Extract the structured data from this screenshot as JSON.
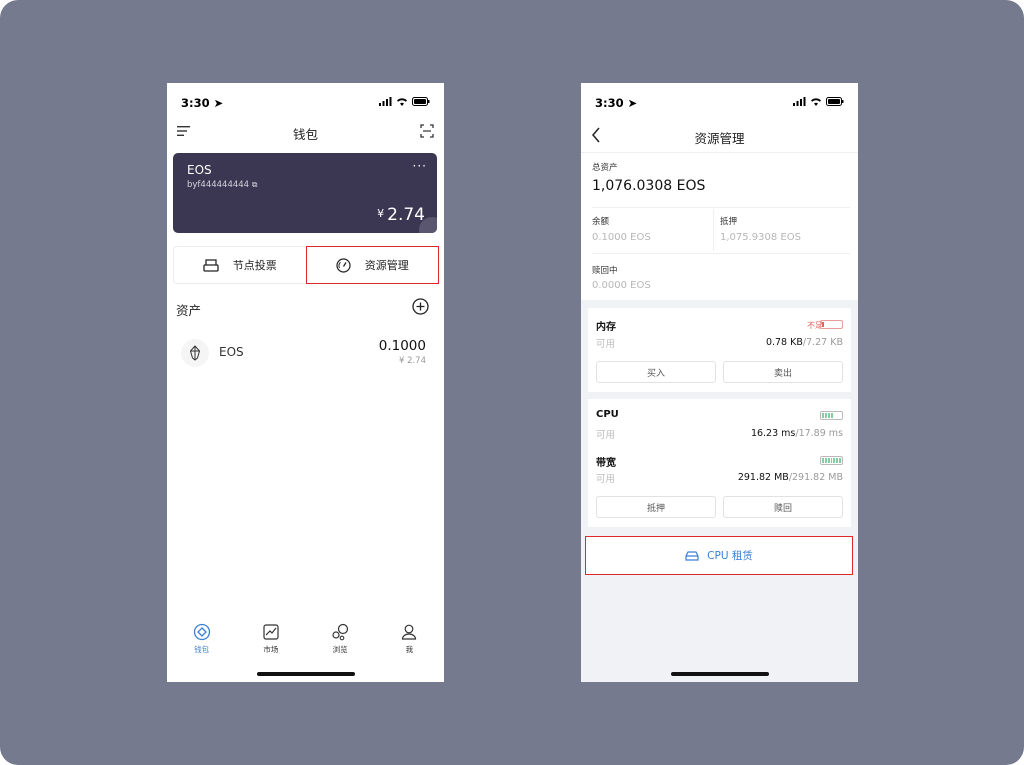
{
  "left": {
    "status": {
      "time": "3:30"
    },
    "nav": {
      "title": "钱包"
    },
    "wallet": {
      "name": "EOS",
      "address": "byf444444444",
      "more": "···",
      "currency": "¥",
      "balance": "2.74"
    },
    "actions": [
      {
        "label": "节点投票",
        "icon": "printer-icon"
      },
      {
        "label": "资源管理",
        "icon": "gauge-icon"
      }
    ],
    "assets": {
      "title": "资产",
      "items": [
        {
          "name": "EOS",
          "amount": "0.1000",
          "fiat": "¥ 2.74"
        }
      ]
    },
    "tabbar": [
      {
        "label": "钱包",
        "icon": "wallet-icon",
        "active": true
      },
      {
        "label": "市场",
        "icon": "chart-icon",
        "active": false
      },
      {
        "label": "浏览",
        "icon": "bubbles-icon",
        "active": false
      },
      {
        "label": "我",
        "icon": "user-icon",
        "active": false
      }
    ]
  },
  "right": {
    "status": {
      "time": "3:30"
    },
    "nav": {
      "title": "资源管理"
    },
    "summary": {
      "total_label": "总资产",
      "total_value": "1,076.0308 EOS",
      "balance_label": "余额",
      "balance_value": "0.1000 EOS",
      "staked_label": "抵押",
      "staked_value": "1,075.9308 EOS",
      "redeeming_label": "赎回中",
      "redeeming_value": "0.0000 EOS"
    },
    "ram": {
      "title": "内存",
      "status": "不足",
      "available_label": "可用",
      "used": "0.78 KB",
      "total": "/7.27 KB",
      "buy_label": "买入",
      "sell_label": "卖出"
    },
    "cpu": {
      "title": "CPU",
      "available_label": "可用",
      "used": "16.23 ms",
      "total": "/17.89 ms"
    },
    "net": {
      "title": "带宽",
      "available_label": "可用",
      "used": "291.82 MB",
      "total": "/291.82 MB"
    },
    "stake": {
      "stake_label": "抵押",
      "redeem_label": "赎回"
    },
    "cpu_rent": {
      "label": "CPU 租赁"
    }
  },
  "colors": {
    "background": "#757a8e",
    "card": "#3b3752",
    "accent": "#3d7fd6",
    "highlight": "#e02828"
  }
}
